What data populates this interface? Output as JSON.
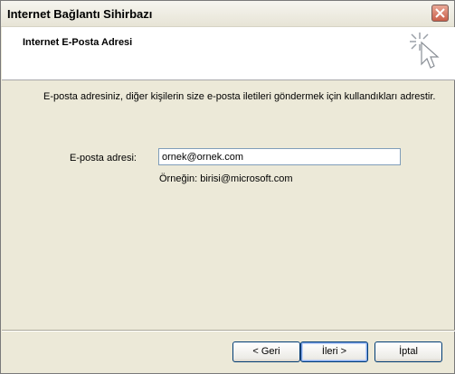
{
  "window": {
    "title": "Internet Bağlantı Sihirbazı"
  },
  "header": {
    "title": "Internet E-Posta Adresi"
  },
  "main": {
    "description": "E-posta adresiniz, diğer kişilerin size e-posta iletileri göndermek için kullandıkları adrestir.",
    "email_label": "E-posta adresi:",
    "email_value": "ornek@ornek.com",
    "example": "Örneğin: birisi@microsoft.com"
  },
  "buttons": {
    "back": "< Geri",
    "next": "İleri >",
    "cancel": "İptal"
  },
  "icons": {
    "close": "close-icon",
    "wizard": "wizard-cursor-icon"
  },
  "colors": {
    "background": "#ece9d8",
    "close_button": "#c95f4a",
    "input_border": "#7f9db9"
  }
}
